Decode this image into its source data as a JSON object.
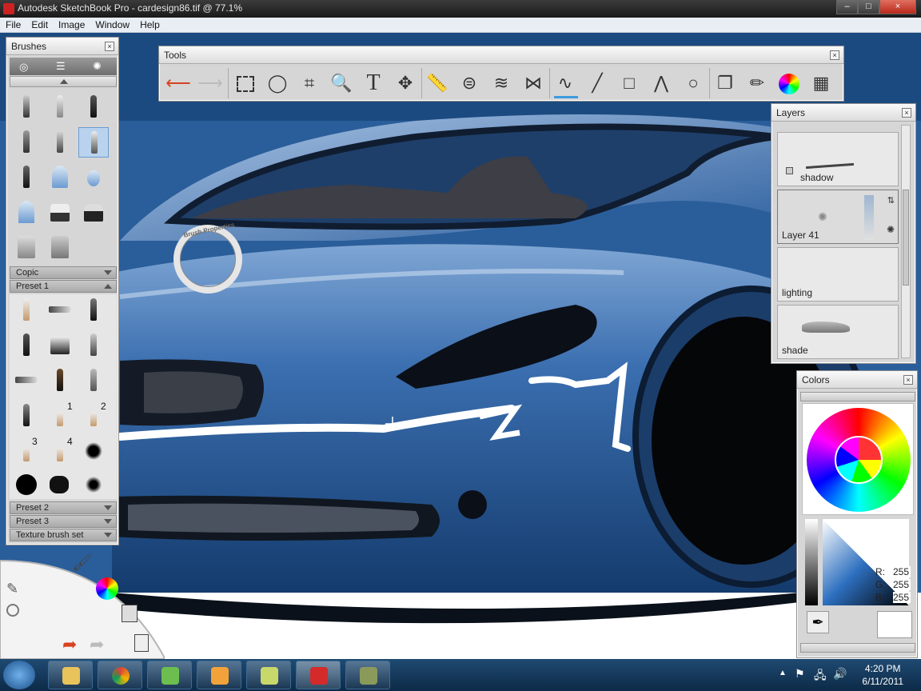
{
  "window": {
    "title": "Autodesk SketchBook Pro - cardesign86.tif @ 77.1%",
    "min": "–",
    "max": "□",
    "close": "×"
  },
  "menu": [
    "File",
    "Edit",
    "Image",
    "Window",
    "Help"
  ],
  "tools": {
    "title": "Tools",
    "close": "×",
    "text_tool": "T"
  },
  "brushes": {
    "title": "Brushes",
    "close": "×",
    "sets": [
      "Copic",
      "Preset 1",
      "Preset 2",
      "Preset 3",
      "Texture brush set"
    ],
    "numbers": [
      "1",
      "2",
      "3",
      "4"
    ]
  },
  "lagoon": {
    "label": "Brush Properties"
  },
  "layers": {
    "title": "Layers",
    "close": "×",
    "items": [
      "shadow",
      "Layer 41",
      "lighting",
      "shade"
    ]
  },
  "colors": {
    "title": "Colors",
    "close": "×",
    "r_label": "R:",
    "r": "255",
    "g_label": "G:",
    "g": "255",
    "b_label": "B:",
    "b": "255"
  },
  "taskbar": {
    "time": "4:20 PM",
    "date": "6/11/2011"
  },
  "theme": {
    "canvas_blue": "#1d4e86",
    "panel_gray": "#d6d6d6",
    "accent_red": "#d64321"
  }
}
